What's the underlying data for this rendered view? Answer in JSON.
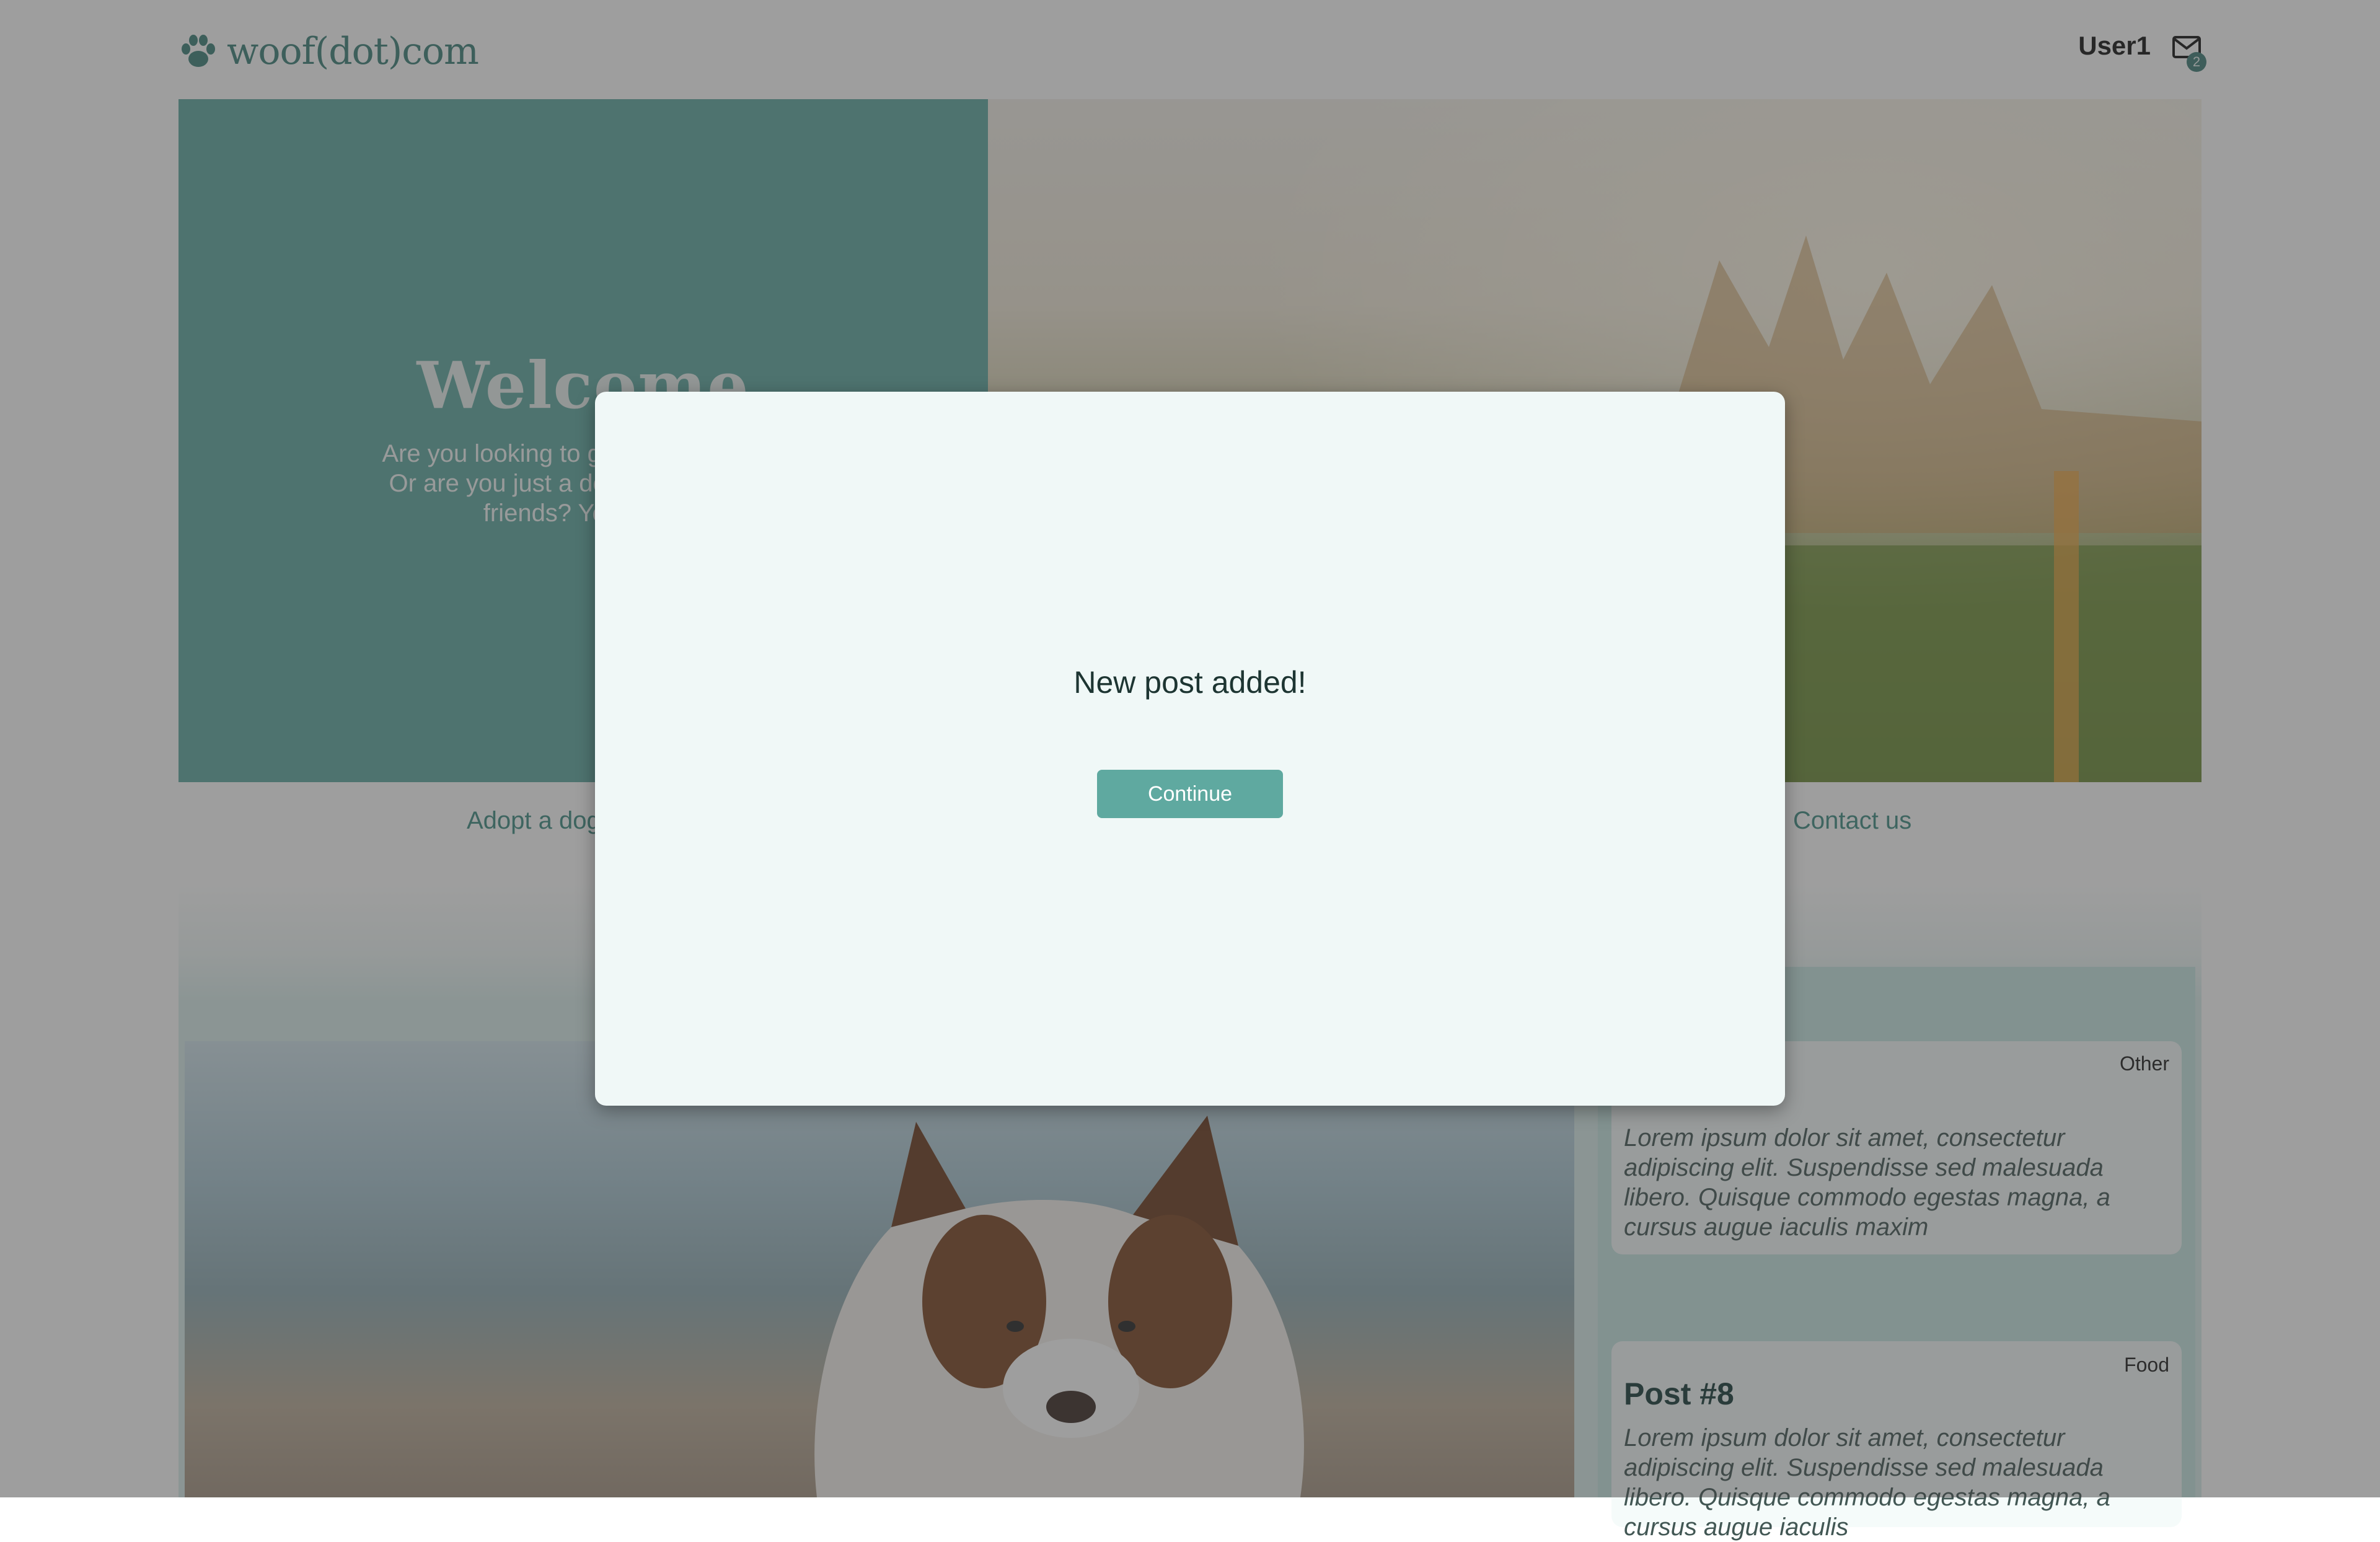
{
  "header": {
    "logo_text": "woof(dot)com",
    "user_name": "User1",
    "mail_badge": "2"
  },
  "hero": {
    "title": "Welcome",
    "intro_lines": [
      "Are you looking to get a new dog? M",
      "Or are you just a dog lover who like",
      "friends? You are a"
    ]
  },
  "nav": {
    "adopt": "Adopt a dog",
    "contact": "Contact us"
  },
  "posts": [
    {
      "category": "Other",
      "title": "",
      "text": "Lorem ipsum dolor sit amet, consectetur adipiscing elit. Suspendisse sed malesuada libero. Quisque commodo egestas magna, a cursus augue iaculis maxim"
    },
    {
      "category": "Food",
      "title": "Post #8",
      "text": "Lorem ipsum dolor sit amet, consectetur adipiscing elit. Suspendisse sed malesuada libero. Quisque commodo egestas magna, a cursus augue iaculis"
    }
  ],
  "modal": {
    "message": "New post added!",
    "button_label": "Continue"
  },
  "colors": {
    "accent": "#5fa9a0",
    "accent_dark": "#3f7d76",
    "modal_bg": "#f0f8f7"
  }
}
